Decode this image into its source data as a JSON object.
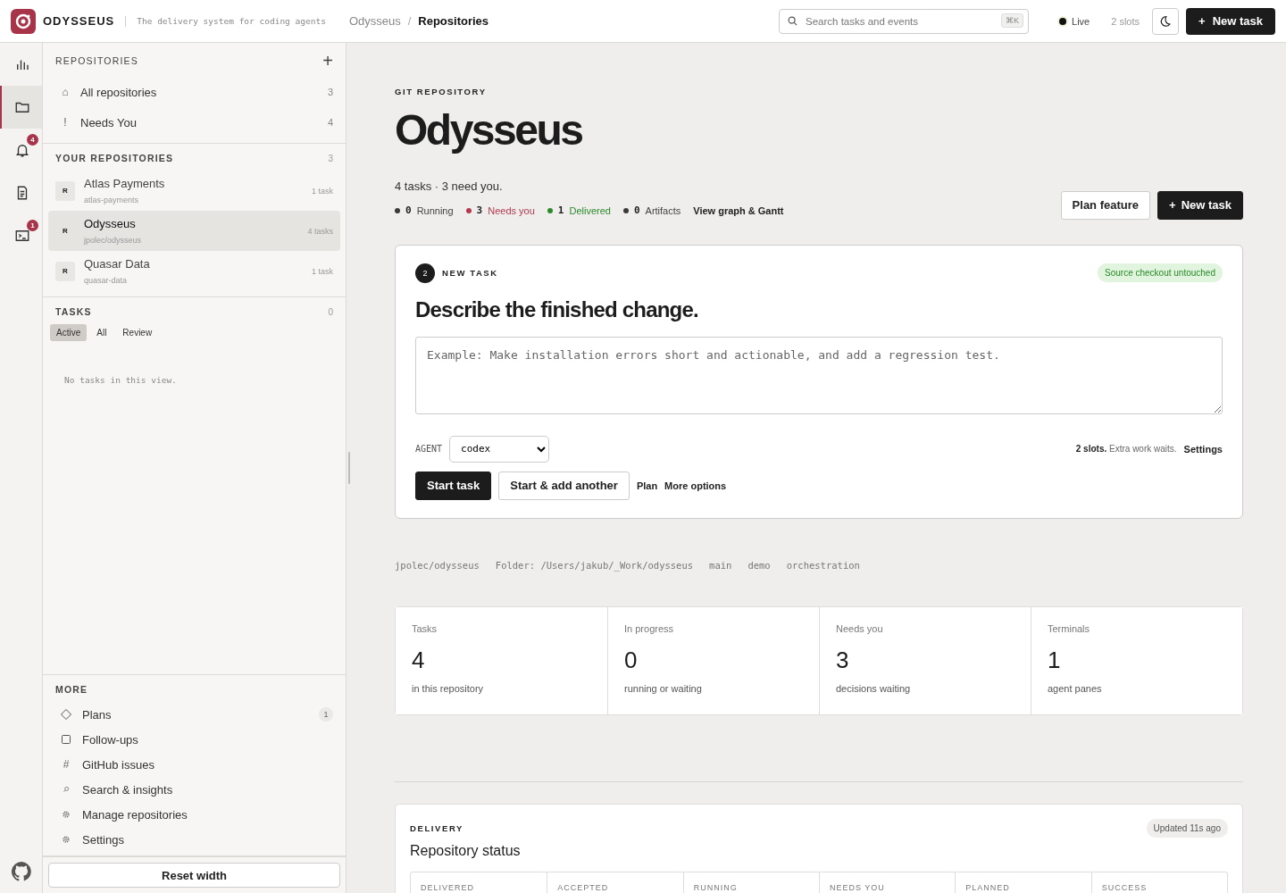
{
  "header": {
    "brand": "ODYSSEUS",
    "tagline": "The delivery system for coding agents",
    "breadcrumb_separator": "/",
    "breadcrumbs": [
      {
        "label": "Odysseus",
        "selected": false
      },
      {
        "label": "Repositories",
        "selected": true
      }
    ],
    "search": {
      "placeholder": "Search tasks and events",
      "shortcut": "⌘K"
    },
    "live": "Live",
    "slots": "2 slots",
    "new_task": {
      "icon": "+",
      "label": "New task"
    }
  },
  "rail": [
    {
      "kind": "chart",
      "selected": false
    },
    {
      "kind": "folder",
      "selected": true
    },
    {
      "kind": "bell",
      "selected": false,
      "badge": "4"
    },
    {
      "kind": "document",
      "selected": false
    },
    {
      "kind": "terminal",
      "selected": false,
      "badge": "1"
    }
  ],
  "sidebar": {
    "repositories": {
      "title": "REPOSITORIES",
      "add": "+",
      "items": [
        {
          "glyph": "⌂",
          "label": "All repositories",
          "count": "3"
        },
        {
          "glyph": "!",
          "label": "Needs You",
          "count": "4"
        }
      ]
    },
    "your_repositories": {
      "title": "YOUR REPOSITORIES",
      "count": "3",
      "repos": [
        {
          "avatar": "R",
          "name": "Atlas Payments",
          "slug": "atlas-payments",
          "count": "1 task",
          "selected": false
        },
        {
          "avatar": "R",
          "name": "Odysseus",
          "slug": "jpolec/odysseus",
          "count": "4 tasks",
          "selected": true
        },
        {
          "avatar": "R",
          "name": "Quasar Data",
          "slug": "quasar-data",
          "count": "1 task",
          "selected": false
        }
      ]
    },
    "tasks": {
      "title": "TASKS",
      "count": "0",
      "filters": [
        {
          "label": "Active",
          "selected": true
        },
        {
          "label": "All",
          "selected": false
        },
        {
          "label": "Review",
          "selected": false
        }
      ],
      "empty": "No tasks in this view."
    },
    "more": {
      "title": "MORE",
      "items": [
        {
          "kind": "diamond",
          "label": "Plans",
          "badge": "1"
        },
        {
          "kind": "square",
          "label": "Follow-ups"
        },
        {
          "kind": "glyph",
          "glyph": "#",
          "label": "GitHub issues"
        },
        {
          "kind": "search",
          "label": "Search & insights"
        },
        {
          "kind": "gear",
          "label": "Manage repositories"
        },
        {
          "kind": "gear",
          "label": "Settings"
        }
      ]
    },
    "reset": "Reset width"
  },
  "main": {
    "eyebrow": "GIT REPOSITORY",
    "title": "Odysseus",
    "summary": "4 tasks · 3 need you.",
    "stats": [
      {
        "value": "0",
        "label": "Running",
        "color": "#3a3a3a"
      },
      {
        "value": "3",
        "label": "Needs you",
        "color": "#b03a4e"
      },
      {
        "value": "1",
        "label": "Delivered",
        "color": "#2a8a2a"
      },
      {
        "value": "0",
        "label": "Artifacts",
        "color": "#3a3a3a"
      }
    ],
    "graph_link": "View graph & Gantt",
    "actions": [
      {
        "kind": "secondary",
        "label": "Plan feature"
      },
      {
        "kind": "primary",
        "icon": "+",
        "label": "New task"
      }
    ],
    "new_task": {
      "step": "2",
      "eyebrow": "NEW TASK",
      "badge": "Source checkout untouched",
      "heading": "Describe the finished change.",
      "placeholder": "Example: Make installation errors short and actionable, and add a regression test.",
      "agent_label": "AGENT",
      "agent": "codex",
      "slots_note": "**2 slots.** Extra work waits.",
      "settings_link": "Settings",
      "buttons": [
        {
          "kind": "primary",
          "label": "Start task"
        },
        {
          "kind": "secondary",
          "label": "Start & add another"
        },
        {
          "kind": "link",
          "label": "Plan"
        },
        {
          "kind": "link",
          "label": "More options"
        }
      ]
    },
    "meta": [
      "jpolec/odysseus",
      "Folder: /Users/jakub/_Work/odysseus",
      "main",
      "demo",
      "orchestration"
    ],
    "metrics": [
      {
        "label": "Tasks",
        "value": "4",
        "note": "in this repository"
      },
      {
        "label": "In progress",
        "value": "0",
        "note": "running or waiting"
      },
      {
        "label": "Needs you",
        "value": "3",
        "note": "decisions waiting"
      },
      {
        "label": "Terminals",
        "value": "1",
        "note": "agent panes"
      }
    ],
    "delivery": {
      "eyebrow": "DELIVERY",
      "title": "Repository status",
      "updated": "Updated 11s ago",
      "columns": [
        "DELIVERED",
        "ACCEPTED",
        "RUNNING",
        "NEEDS YOU",
        "PLANNED",
        "SUCCESS"
      ]
    }
  }
}
